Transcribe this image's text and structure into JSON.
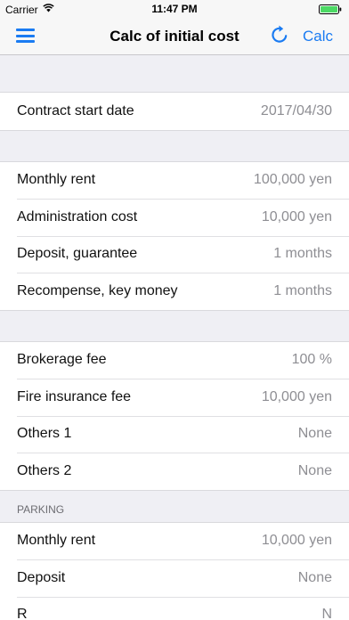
{
  "status_bar": {
    "carrier": "Carrier",
    "time": "11:47 PM"
  },
  "nav": {
    "title": "Calc of initial cost",
    "calc_label": "Calc",
    "menu_icon": "hamburger-menu-icon",
    "refresh_icon": "refresh-icon"
  },
  "colors": {
    "accent": "#1a7bf2",
    "battery": "#4cd964",
    "background": "#efeff4",
    "value_text": "#8e8e93"
  },
  "groups": [
    {
      "rows": [
        {
          "label": "Contract start date",
          "value": "2017/04/30"
        }
      ]
    },
    {
      "rows": [
        {
          "label": "Monthly rent",
          "value": "100,000 yen"
        },
        {
          "label": "Administration cost",
          "value": "10,000 yen"
        },
        {
          "label": "Deposit, guarantee",
          "value": "1 months"
        },
        {
          "label": "Recompense, key money",
          "value": "1 months"
        }
      ]
    },
    {
      "rows": [
        {
          "label": "Brokerage fee",
          "value": "100 %"
        },
        {
          "label": "Fire insurance fee",
          "value": "10,000 yen"
        },
        {
          "label": "Others 1",
          "value": "None"
        },
        {
          "label": "Others 2",
          "value": "None"
        }
      ]
    },
    {
      "header": "PARKING",
      "rows": [
        {
          "label": "Monthly rent",
          "value": "10,000 yen"
        },
        {
          "label": "Deposit",
          "value": "None"
        },
        {
          "label": "R",
          "value": "N"
        }
      ]
    }
  ]
}
